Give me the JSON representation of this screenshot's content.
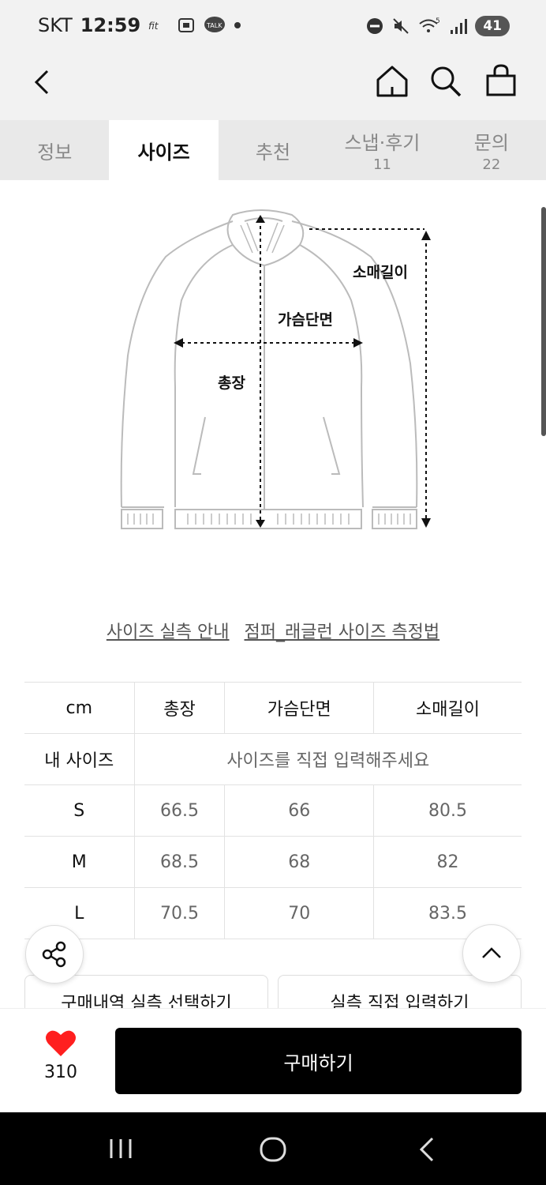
{
  "status_bar": {
    "carrier": "SKT",
    "time": "12:59",
    "battery": "41",
    "talk_badge": "TALK",
    "wifi_badge": "5"
  },
  "tabs": [
    {
      "label": "정보",
      "count": ""
    },
    {
      "label": "사이즈",
      "count": ""
    },
    {
      "label": "추천",
      "count": ""
    },
    {
      "label": "스냅·후기",
      "count": "11"
    },
    {
      "label": "문의",
      "count": "22"
    }
  ],
  "diagram": {
    "sleeve_label": "소매길이",
    "chest_label": "가슴단면",
    "length_label": "총장"
  },
  "links": {
    "size_guide": "사이즈 실측 안내",
    "measure_method": "점퍼_래글런 사이즈 측정법"
  },
  "size_table": {
    "headers": [
      "cm",
      "총장",
      "가슴단면",
      "소매길이"
    ],
    "my_size_label": "내 사이즈",
    "my_size_prompt": "사이즈를 직접 입력해주세요",
    "rows": [
      {
        "size": "S",
        "length": "66.5",
        "chest": "66",
        "sleeve": "80.5"
      },
      {
        "size": "M",
        "length": "68.5",
        "chest": "68",
        "sleeve": "82"
      },
      {
        "size": "L",
        "length": "70.5",
        "chest": "70",
        "sleeve": "83.5"
      }
    ]
  },
  "actions": {
    "select_from_purchase": "구매내역 실측 선택하기",
    "enter_directly": "실측 직접 입력하기"
  },
  "purchase": {
    "like_count": "310",
    "buy_label": "구매하기"
  },
  "colors": {
    "heart": "#ff1f1f",
    "buy_bg": "#000000",
    "tab_bg": "#e9e9e9"
  }
}
